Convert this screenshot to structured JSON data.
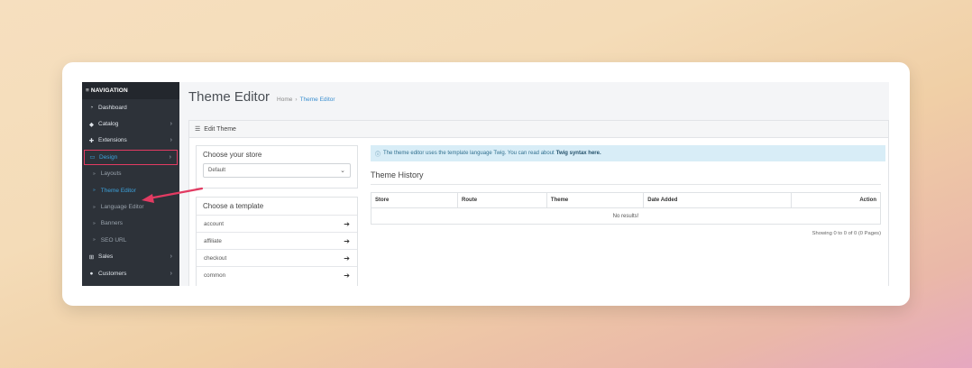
{
  "sidebar": {
    "header": "NAVIGATION",
    "items": [
      {
        "label": "Dashboard",
        "icon": "dashboard-icon"
      },
      {
        "label": "Catalog",
        "icon": "tag-icon"
      },
      {
        "label": "Extensions",
        "icon": "puzzle-icon"
      },
      {
        "label": "Design",
        "icon": "monitor-icon"
      }
    ],
    "design_sub": [
      "Layouts",
      "Theme Editor",
      "Language Editor",
      "Banners",
      "SEO URL"
    ],
    "bottom_items": [
      {
        "label": "Sales",
        "icon": "cart-icon"
      },
      {
        "label": "Customers",
        "icon": "user-icon"
      }
    ]
  },
  "header": {
    "title": "Theme Editor",
    "breadcrumb": [
      "Home",
      "Theme Editor"
    ]
  },
  "panel": {
    "title": "Edit Theme",
    "store_box_title": "Choose your store",
    "store_selected": "Default",
    "template_box_title": "Choose a template",
    "templates": [
      "account",
      "affiliate",
      "checkout",
      "common"
    ]
  },
  "info": {
    "text": "The theme editor uses the template language Twig. You can read about",
    "link": "Twig syntax here."
  },
  "history": {
    "title": "Theme History",
    "columns": [
      "Store",
      "Route",
      "Theme",
      "Date Added",
      "Action"
    ],
    "empty": "No results!",
    "showing": "Showing 0 to 0 of 0 (0 Pages)"
  },
  "colors": {
    "accent": "#3ca3de",
    "highlight": "#e23b62",
    "sidebar_bg": "#2d3239"
  }
}
